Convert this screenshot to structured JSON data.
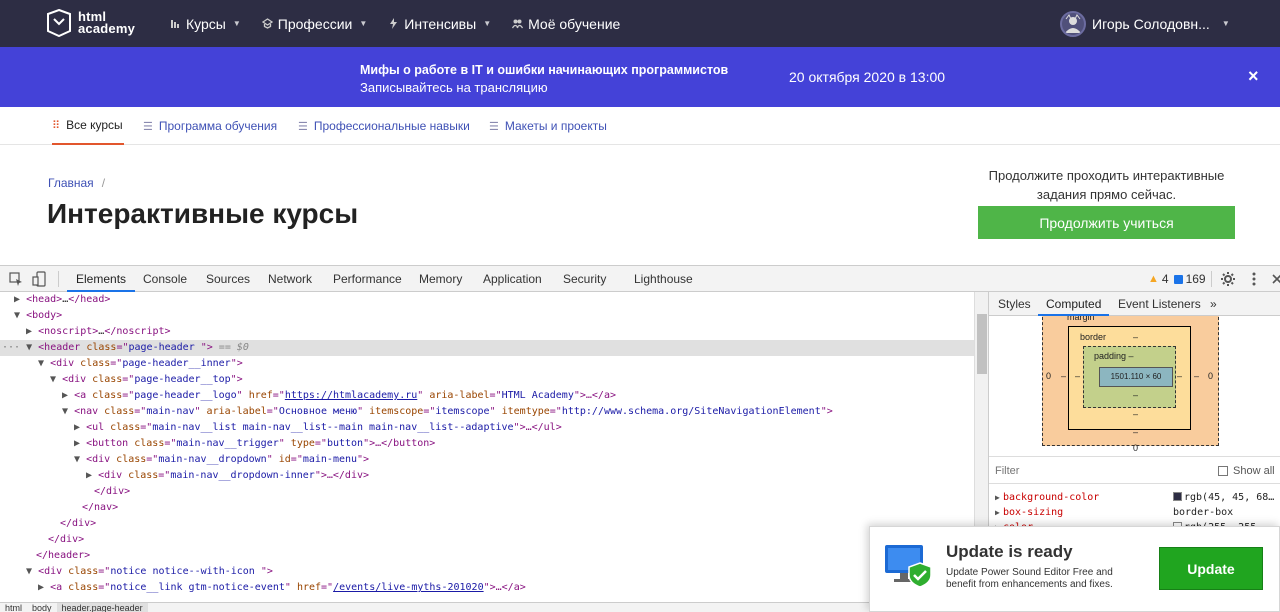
{
  "site": {
    "logo": {
      "line1": "html",
      "line2": "academy"
    },
    "nav": [
      {
        "label": "Курсы",
        "icon": "courses-icon"
      },
      {
        "label": "Профессии",
        "icon": "professions-icon"
      },
      {
        "label": "Интенсивы",
        "icon": "lightning-icon"
      },
      {
        "label": "Моё обучение",
        "icon": "learning-icon"
      }
    ],
    "user": {
      "name": "Игорь Солодовн..."
    }
  },
  "promo": {
    "title": "Мифы о работе в IT и ошибки начинающих программистов",
    "subtitle": "Записывайтесь на трансляцию",
    "date": "20 октября 2020 в 13:00",
    "close": "×"
  },
  "subtabs": [
    {
      "label": "Все курсы",
      "active": true
    },
    {
      "label": "Программа обучения",
      "active": false
    },
    {
      "label": "Профессиональные навыки",
      "active": false
    },
    {
      "label": "Макеты и проекты",
      "active": false
    }
  ],
  "page": {
    "breadcrumb": {
      "home": "Главная",
      "sep": "/"
    },
    "title": "Интерактивные курсы",
    "cta_text": "Продолжите проходить интерактивные задания прямо сейчас.",
    "cta_button": "Продолжить учиться"
  },
  "devtools": {
    "tabs": [
      "Elements",
      "Console",
      "Sources",
      "Network",
      "Performance",
      "Memory",
      "Application",
      "Security",
      "Lighthouse"
    ],
    "active_tab": "Elements",
    "warnings": "4",
    "messages": "169",
    "dom": {
      "l0": {
        "tri": "▶",
        "a": "<head>",
        "b": "…",
        "c": "</head>"
      },
      "l1": {
        "tri": "▼",
        "a": "<body>"
      },
      "l2": {
        "tri": "▶",
        "a": "<noscript>",
        "b": "…",
        "c": "</noscript>"
      },
      "l3": {
        "dots": "···",
        "tri": "▼",
        "a": "<header ",
        "attr": "class",
        "eq": "=\"",
        "val": "page-header ",
        "close": "\">",
        "marker": " == $0"
      },
      "l4": {
        "tri": "▼",
        "a": "<div ",
        "attr": "class",
        "eq": "=\"",
        "val": "page-header__inner",
        "close": "\">"
      },
      "l5": {
        "tri": "▼",
        "a": "<div ",
        "attr": "class",
        "eq": "=\"",
        "val": "page-header__top",
        "close": "\">"
      },
      "l6": {
        "tri": "▶",
        "a": "<a ",
        "attr1": "class",
        "val1": "page-header__logo",
        "attr2": "href",
        "link": "https://htmlacademy.ru",
        "attr3": "aria-label",
        "val3": "HTML Academy",
        "end": "\">…</a>"
      },
      "l7": {
        "tri": "▼",
        "a": "<nav ",
        "attr1": "class",
        "val1": "main-nav",
        "attr2": "aria-label",
        "val2": "Основное меню",
        "attr3": "itemscope",
        "val3": "itemscope",
        "attr4": "itemtype",
        "val4": "http://www.schema.org/SiteNavigationElement",
        "end": "\">"
      },
      "l8": {
        "tri": "▶",
        "a": "<ul ",
        "attr": "class",
        "val": "main-nav__list main-nav__list--main main-nav__list--adaptive",
        "end": "\">…</ul>"
      },
      "l9": {
        "tri": "▶",
        "a": "<button ",
        "attr1": "class",
        "val1": "main-nav__trigger",
        "attr2": "type",
        "val2": "button",
        "end": "\">…</button>"
      },
      "l10": {
        "tri": "▼",
        "a": "<div ",
        "attr1": "class",
        "val1": "main-nav__dropdown",
        "attr2": "id",
        "val2": "main-menu",
        "end": "\">"
      },
      "l11": {
        "tri": "▶",
        "a": "<div ",
        "attr": "class",
        "val": "main-nav__dropdown-inner",
        "end": "\">…</div>"
      },
      "l12": {
        "a": "</div>"
      },
      "l13": {
        "a": "</nav>"
      },
      "l14": {
        "a": "</div>"
      },
      "l15": {
        "a": "</div>"
      },
      "l16": {
        "a": "</header>"
      },
      "l17": {
        "tri": "▼",
        "a": "<div ",
        "attr": "class",
        "val": "notice notice--with-icon ",
        "end": "\">"
      },
      "l18": {
        "tri": "▶",
        "a": "<a ",
        "attr1": "class",
        "val1": "notice__link gtm-notice-event",
        "attr2": "href",
        "link": "/events/live-myths-201020",
        "end": "\">…</a>"
      }
    },
    "breadcrumb": [
      "html",
      "body",
      "header.page-header"
    ],
    "side_tabs": [
      "Styles",
      "Computed",
      "Event Listeners",
      "»"
    ],
    "side_active": "Computed",
    "boxmodel": {
      "margin_label": "margin",
      "border_label": "border",
      "padding_label": "padding –",
      "content": "1501.110 × 60",
      "dash": "–",
      "zero": "0"
    },
    "filter_placeholder": "Filter",
    "show_all": "Show all",
    "props": [
      {
        "name": "background-color",
        "value": "rgb(45, 45, 68…",
        "swatch": "#2d2d44"
      },
      {
        "name": "box-sizing",
        "value": "border-box"
      },
      {
        "name": "color",
        "value": "rgb(255, 255, …",
        "swatch": "#ffffff"
      }
    ]
  },
  "popup": {
    "title": "Update is ready",
    "text": "Update Power Sound Editor Free and benefit from enhancements and fixes.",
    "button": "Update"
  },
  "colors": {
    "header_bg": "#2d2d44",
    "promo_bg": "#4442d8",
    "cta_green": "#4fb548",
    "accent_orange": "#e2562d",
    "link_blue": "#3f51b5",
    "update_green": "#20a51f"
  }
}
